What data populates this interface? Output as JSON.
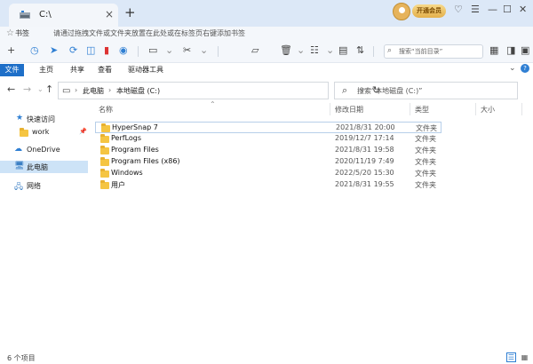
{
  "window": {
    "tab_title": "C:\\",
    "new_tab": "+",
    "close_tab": "×",
    "vip_label": "开通会员",
    "controls": [
      "♡",
      "☰",
      "—",
      "☐",
      "✕"
    ]
  },
  "bookmarks": {
    "label": "书签",
    "hint": "请通过拖拽文件或文件夹放置在此处或在标签页右键添加书签"
  },
  "toolbar": {
    "search_placeholder": "搜索“当前目录”"
  },
  "ribbon": {
    "tabs": [
      "文件",
      "主页",
      "共享",
      "查看",
      "驱动器工具"
    ],
    "active": "文件"
  },
  "address": {
    "crumbs": [
      "此电脑",
      "本地磁盘 (C:)"
    ],
    "search_placeholder": "搜索“本地磁盘 (C:)”"
  },
  "sidebar": {
    "items": [
      {
        "label": "快速访问",
        "icon": "star-icon"
      },
      {
        "label": "work",
        "icon": "folder-icon"
      },
      {
        "label": "OneDrive",
        "icon": "cloud-icon"
      },
      {
        "label": "此电脑",
        "icon": "computer-icon"
      },
      {
        "label": "网络",
        "icon": "network-icon"
      }
    ],
    "selected": "此电脑"
  },
  "filelist": {
    "columns": [
      "名称",
      "修改日期",
      "类型",
      "大小"
    ],
    "rows": [
      {
        "name": "HyperSnap 7",
        "date": "2021/8/31 20:00",
        "type": "文件夹"
      },
      {
        "name": "PerfLogs",
        "date": "2019/12/7 17:14",
        "type": "文件夹"
      },
      {
        "name": "Program Files",
        "date": "2021/8/31 19:58",
        "type": "文件夹"
      },
      {
        "name": "Program Files (x86)",
        "date": "2020/11/19 7:49",
        "type": "文件夹"
      },
      {
        "name": "Windows",
        "date": "2022/5/20 15:30",
        "type": "文件夹"
      },
      {
        "name": "用户",
        "date": "2021/8/31 19:55",
        "type": "文件夹"
      }
    ]
  },
  "status": {
    "item_count": "6 个项目"
  },
  "colors": {
    "accent": "#1e6fc8",
    "titlebar": "#dce8f7",
    "selected": "#cde3f7",
    "folder": "#f5c542"
  }
}
